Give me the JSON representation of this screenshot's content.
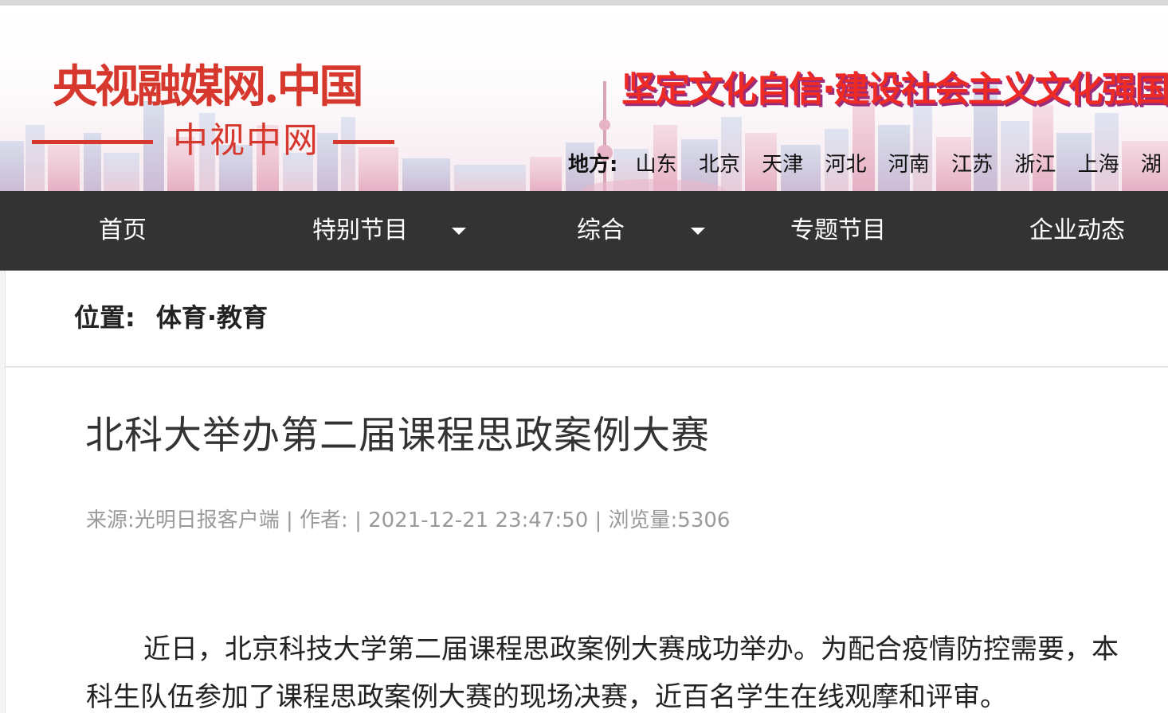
{
  "header": {
    "logo_main": "央视融媒网.中国",
    "logo_sub": "中视中网",
    "slogan": "坚定文化自信·建设社会主义文化强国",
    "region_label": "地方:",
    "regions": [
      "山东",
      "北京",
      "天津",
      "河北",
      "河南",
      "江苏",
      "浙江",
      "上海",
      "湖"
    ]
  },
  "nav": {
    "items": [
      {
        "label": "首页",
        "has_dropdown": false
      },
      {
        "label": "特别节目",
        "has_dropdown": true
      },
      {
        "label": "综合",
        "has_dropdown": true
      },
      {
        "label": "专题节目",
        "has_dropdown": false
      },
      {
        "label": "企业动态",
        "has_dropdown": false
      }
    ]
  },
  "breadcrumb": {
    "label": "位置:",
    "value": "体育·教育"
  },
  "article": {
    "title": "北科大举办第二届课程思政案例大赛",
    "meta": "来源:光明日报客户端 | 作者:  | 2021-12-21 23:47:50 | 浏览量:5306",
    "paragraph_lines": [
      "近日，北京科技大学第二届课程思政案例大赛成功举办。为配合疫情防控需要，本",
      "科生队伍参加了课程思政案例大赛的现场决赛，近百名学生在线观摩和评审。"
    ]
  },
  "colors": {
    "brand_red": "#d6382d",
    "slogan_red": "#ee2a24",
    "slogan_shadow": "#9a2c7b",
    "nav_bg": "#333333",
    "meta_gray": "#9a9a9a"
  }
}
